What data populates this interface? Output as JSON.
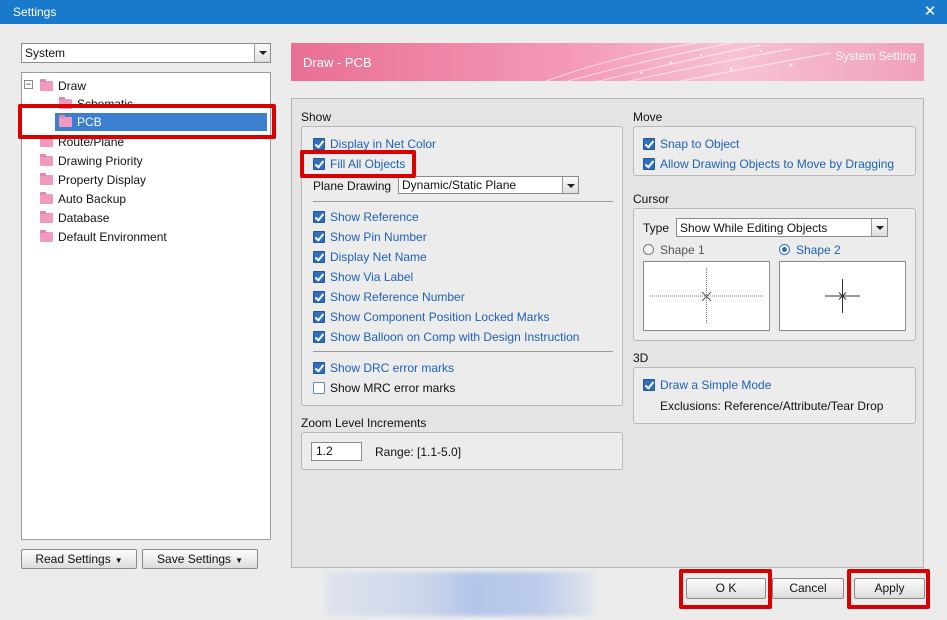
{
  "window": {
    "title": "Settings",
    "close_glyph": "✕"
  },
  "left": {
    "system_select": "System",
    "tree": [
      {
        "label": "Draw"
      },
      {
        "label": "Schematic"
      },
      {
        "label": "PCB"
      },
      {
        "label": "Route/Plane"
      },
      {
        "label": "Drawing Priority"
      },
      {
        "label": "Property Display"
      },
      {
        "label": "Auto Backup"
      },
      {
        "label": "Database"
      },
      {
        "label": "Default Environment"
      }
    ],
    "expander_glyph": "−",
    "read_settings": "Read Settings",
    "save_settings": "Save Settings",
    "dropdown_glyph": "▼"
  },
  "banner": {
    "title": "Draw - PCB",
    "right_text": "System Setting"
  },
  "show": {
    "title": "Show",
    "items": [
      {
        "label": "Display in Net Color",
        "checked": true
      },
      {
        "label": "Fill All Objects",
        "checked": true
      }
    ],
    "plane_drawing_label": "Plane Drawing",
    "plane_drawing_value": "Dynamic/Static Plane",
    "items2": [
      {
        "label": "Show Reference",
        "checked": true
      },
      {
        "label": "Show Pin Number",
        "checked": true
      },
      {
        "label": "Display Net Name",
        "checked": true
      },
      {
        "label": "Show Via Label",
        "checked": true
      },
      {
        "label": "Show Reference Number",
        "checked": true
      },
      {
        "label": "Show Component Position Locked Marks",
        "checked": true
      },
      {
        "label": "Show Balloon on Comp with Design Instruction",
        "checked": true
      }
    ],
    "items3": [
      {
        "label": "Show DRC error marks",
        "checked": true
      },
      {
        "label": "Show MRC error marks",
        "checked": false
      }
    ]
  },
  "zoom": {
    "title": "Zoom Level Increments",
    "value": "1.2",
    "range": "Range: [1.1-5.0]"
  },
  "move": {
    "title": "Move",
    "items": [
      {
        "label": "Snap to Object",
        "checked": true
      },
      {
        "label": "Allow Drawing Objects to Move by Dragging",
        "checked": true
      }
    ]
  },
  "cursor": {
    "title": "Cursor",
    "type_label": "Type",
    "type_value": "Show While Editing Objects",
    "shape1": "Shape 1",
    "shape2": "Shape 2",
    "selected_shape": 2
  },
  "threed": {
    "title": "3D",
    "simple_mode": {
      "label": "Draw a Simple Mode",
      "checked": true
    },
    "exclusions": "Exclusions:  Reference/Attribute/Tear Drop"
  },
  "footer": {
    "ok": "O K",
    "cancel": "Cancel",
    "apply": "Apply"
  },
  "colors": {
    "accent": "#2f6fc0",
    "highlight": "#d90000",
    "titlebar": "#1979ca"
  }
}
